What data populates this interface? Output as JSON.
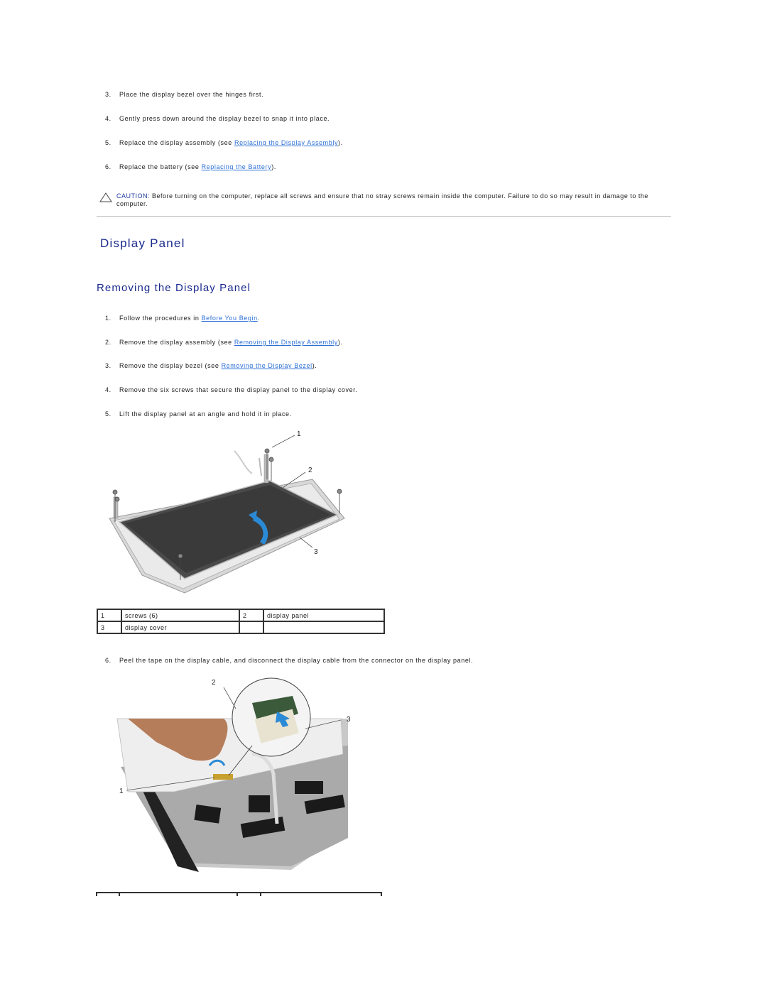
{
  "replace_steps": [
    {
      "num": "3.",
      "text": "Place the display bezel over the hinges first."
    },
    {
      "num": "4.",
      "text": "Gently press down around the display bezel to snap it into place."
    },
    {
      "num": "5.",
      "before": "Replace the display assembly (see ",
      "link": "Replacing the Display Assembly",
      "after": ")."
    },
    {
      "num": "6.",
      "before": "Replace the battery (see ",
      "link": "Replacing the Battery",
      "after": ")."
    }
  ],
  "caution": {
    "icon": "caution-triangle-icon",
    "label": "CAUTION:",
    "text": " Before turning on the computer, replace all screws and ensure that no stray screws remain inside the computer. Failure to do so may result in damage to the computer."
  },
  "section_title": "Display Panel",
  "subsection_title": "Removing the Display Panel",
  "remove_steps": [
    {
      "num": "1.",
      "before": "Follow the procedures in ",
      "link": "Before You Begin",
      "after": "."
    },
    {
      "num": "2.",
      "before": "Remove the display assembly (see ",
      "link": "Removing the Display Assembly",
      "after": ")."
    },
    {
      "num": "3.",
      "before": "Remove the display bezel (see ",
      "link": "Removing the Display Bezel",
      "after": ")."
    },
    {
      "num": "4.",
      "text": "Remove the six screws that secure the display panel to the display cover."
    },
    {
      "num": "5.",
      "text": "Lift the display panel at an angle and hold it in place."
    },
    {
      "num": "6.",
      "text": "Peel the tape on the display cable, and disconnect the display cable from the connector on the display panel."
    }
  ],
  "figure1": {
    "callouts": [
      "1",
      "2",
      "3"
    ]
  },
  "legend1": [
    [
      "1",
      "screws (6)",
      "2",
      "display panel"
    ],
    [
      "3",
      "display cover",
      "",
      ""
    ]
  ],
  "figure2": {
    "callouts": [
      "1",
      "2",
      "3"
    ]
  },
  "colors": {
    "heading": "#1a2a8e",
    "link": "#2a6fd6",
    "caution_label": "#1f3a9e",
    "arrow": "#2a8ad6"
  }
}
